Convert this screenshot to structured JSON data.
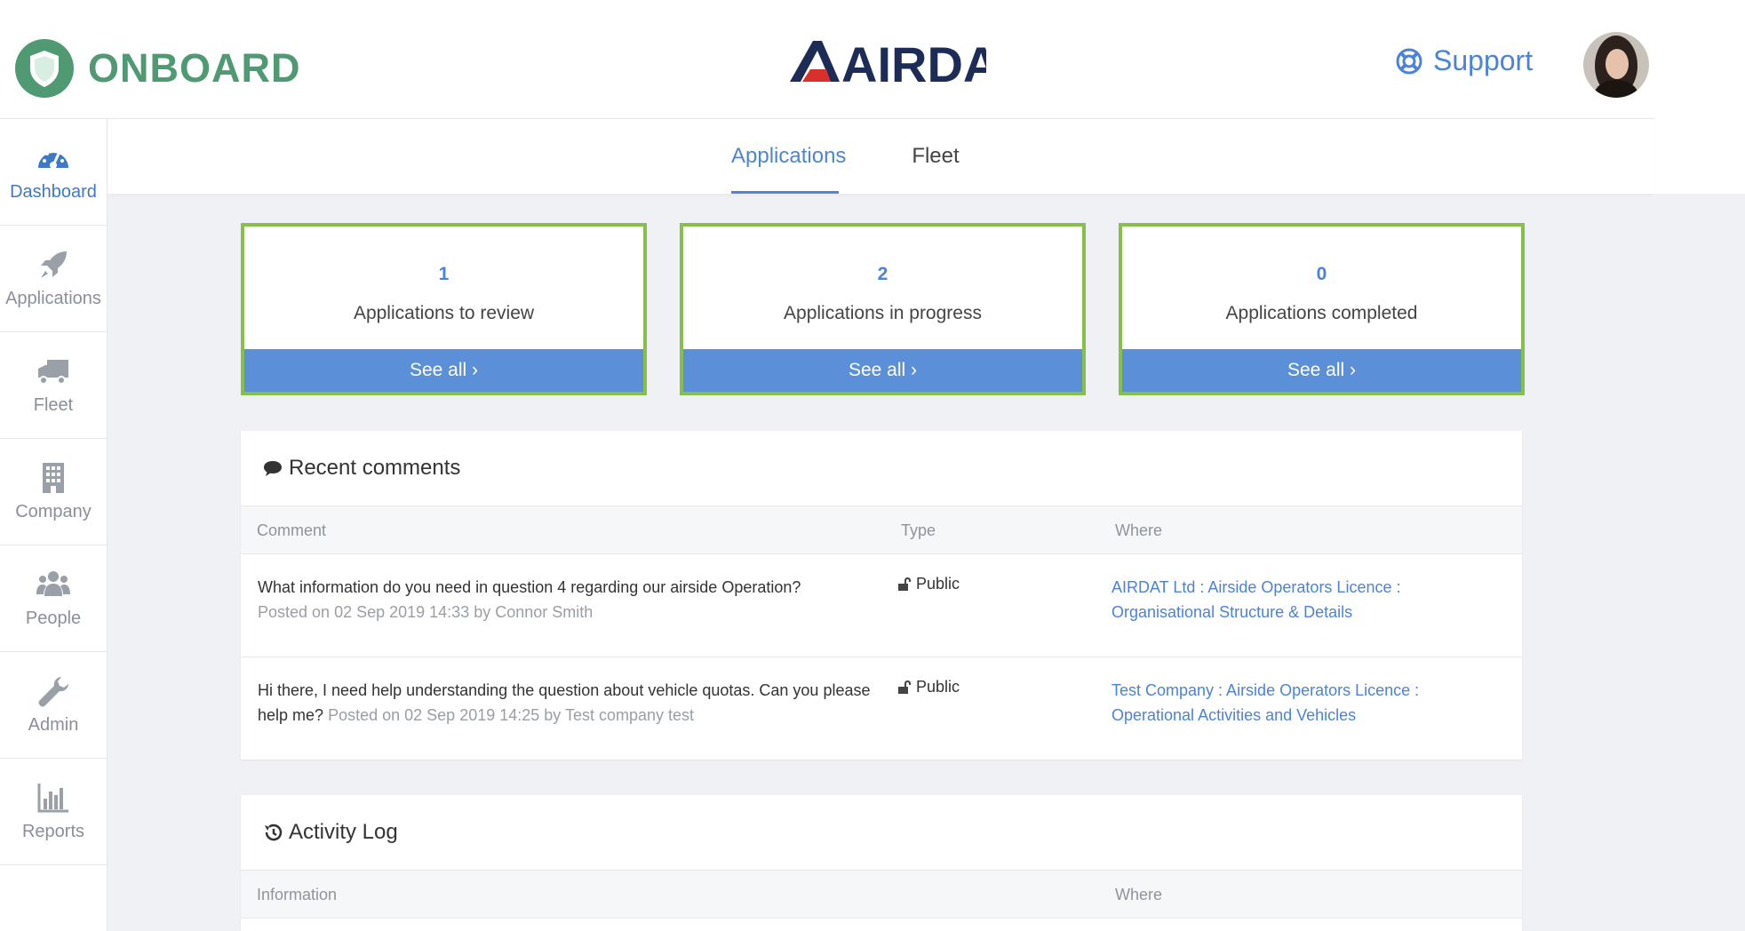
{
  "header": {
    "app_name": "ONBOARD",
    "client_brand": "AIRDAT",
    "support_label": "Support"
  },
  "sidebar": {
    "items": [
      {
        "label": "Dashboard",
        "icon": "dashboard-icon",
        "active": true
      },
      {
        "label": "Applications",
        "icon": "rocket-icon",
        "active": false
      },
      {
        "label": "Fleet",
        "icon": "truck-icon",
        "active": false
      },
      {
        "label": "Company",
        "icon": "building-icon",
        "active": false
      },
      {
        "label": "People",
        "icon": "users-icon",
        "active": false
      },
      {
        "label": "Admin",
        "icon": "wrench-icon",
        "active": false
      },
      {
        "label": "Reports",
        "icon": "bar-chart-icon",
        "active": false
      }
    ]
  },
  "tabs": [
    {
      "label": "Applications",
      "active": true
    },
    {
      "label": "Fleet",
      "active": false
    }
  ],
  "cards": [
    {
      "count": "1",
      "label": "Applications to review",
      "button": "See all ›"
    },
    {
      "count": "2",
      "label": "Applications in progress",
      "button": "See all ›"
    },
    {
      "count": "0",
      "label": "Applications completed",
      "button": "See all ›"
    }
  ],
  "comments": {
    "title": "Recent comments",
    "headers": {
      "comment": "Comment",
      "type": "Type",
      "where": "Where"
    },
    "rows": [
      {
        "text": "What information do you need in question 4 regarding our airside Operation?",
        "meta": "Posted on 02 Sep 2019 14:33 by Connor Smith",
        "type": "Public",
        "where": "AIRDAT Ltd : Airside Operators Licence : Organisational Structure & Details"
      },
      {
        "text": "Hi there, I need help understanding the question about vehicle quotas. Can you please help me?",
        "meta": "Posted on 02 Sep 2019 14:25 by Test company test",
        "type": "Public",
        "where": "Test Company : Airside Operators Licence : Operational Activities and Vehicles"
      }
    ]
  },
  "activity": {
    "title": "Activity Log",
    "headers": {
      "information": "Information",
      "where": "Where"
    }
  },
  "colors": {
    "accent": "#4c83d6",
    "card_border": "#86c04a",
    "button": "#5b8fd8",
    "brand_green": "#4f9a72"
  }
}
